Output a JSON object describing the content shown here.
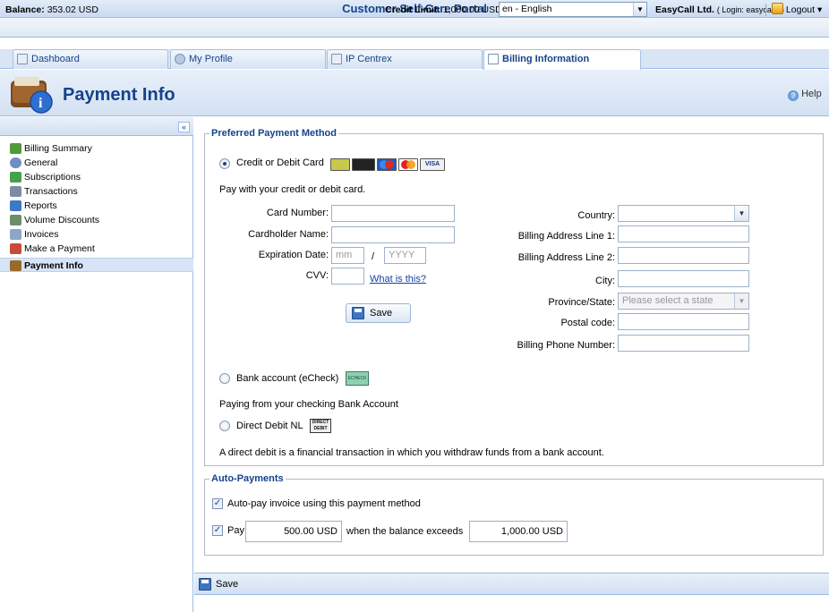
{
  "app": {
    "title": "Customer Self-Care Portal",
    "balance_label": "Balance:",
    "balance_value": "353.02 USD",
    "credit_label": "Credit Limit:",
    "credit_value": "1,000.00 USD",
    "language": "en - English",
    "company": "EasyCall Ltd.",
    "login_text": "( Login: easycalls )",
    "logout": "Logout"
  },
  "tabs": [
    {
      "label": "Dashboard",
      "icon": "dashboard-icon"
    },
    {
      "label": "My Profile",
      "icon": "profile-icon"
    },
    {
      "label": "IP Centrex",
      "icon": "ip-centrex-icon"
    },
    {
      "label": "Billing Information",
      "icon": "billing-icon",
      "active": true
    }
  ],
  "page": {
    "title": "Payment Info",
    "help": "Help"
  },
  "sidebar": {
    "collapse_glyph": "«",
    "items": [
      {
        "label": "Billing Summary",
        "color": "#4f9a3a"
      },
      {
        "label": "General",
        "color": "#6f8fbf"
      },
      {
        "label": "Subscriptions",
        "color": "#48a04a"
      },
      {
        "label": "Transactions",
        "color": "#7a8da8"
      },
      {
        "label": "Reports",
        "color": "#3c79c8"
      },
      {
        "label": "Volume Discounts",
        "color": "#6a8f6a"
      },
      {
        "label": "Invoices",
        "color": "#8fa6c4"
      },
      {
        "label": "Make a Payment",
        "color": "#c84a3a"
      },
      {
        "label": "Payment Info",
        "color": "#9a6a2a",
        "active": true
      }
    ]
  },
  "payment_method": {
    "legend": "Preferred Payment Method",
    "credit_card_label": "Credit or Debit Card",
    "credit_card_desc": "Pay with your credit or debit card.",
    "card_number_label": "Card Number:",
    "cardholder_label": "Cardholder Name:",
    "expiration_label": "Expiration Date:",
    "exp_month_placeholder": "mm",
    "exp_sep": "/",
    "exp_year_placeholder": "YYYY",
    "cvv_label": "CVV:",
    "what_is_this": "What is this?",
    "save_label": "Save",
    "country_label": "Country:",
    "billing1_label": "Billing Address Line 1:",
    "billing2_label": "Billing Address Line 2:",
    "city_label": "City:",
    "province_label": "Province/State:",
    "province_placeholder": "Please select a state",
    "postal_label": "Postal code:",
    "phone_label": "Billing Phone Number:",
    "bank_label": "Bank account (eCheck)",
    "echeck_badge": "ECHECK",
    "bank_desc": "Paying from your checking Bank Account",
    "direct_debit_label": "Direct Debit NL",
    "direct_debit_badge": "DIRECT DEBIT",
    "direct_debit_desc": "A direct debit is a financial transaction in which you withdraw funds from a bank account.",
    "card_badges": [
      "#c8c84a",
      "#222222",
      "#d42b2b",
      "#e8641c",
      "#e8e8e8"
    ],
    "visa_text": "VISA"
  },
  "auto_payments": {
    "legend": "Auto-Payments",
    "autopay_label": "Auto-pay invoice using this payment method",
    "autopay_checked": true,
    "pay_label": "Pay",
    "pay_checked": true,
    "pay_amount": "500.00 USD",
    "when_label": "when the balance exceeds",
    "threshold": "1,000.00 USD"
  },
  "bottom": {
    "save_label": "Save"
  }
}
